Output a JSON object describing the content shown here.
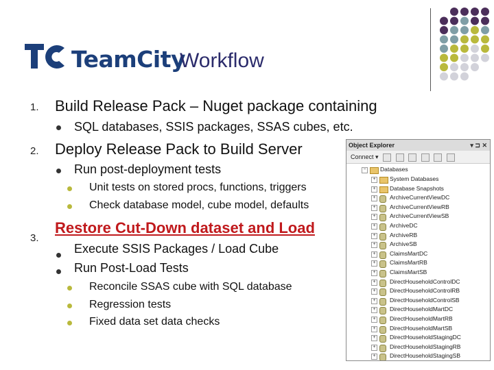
{
  "header": {
    "logo_text": "TeamCity",
    "title": "Workflow"
  },
  "colors": {
    "dot_purple": "#4b2e5a",
    "dot_teal": "#7f9ea6",
    "dot_olive": "#b9b93c",
    "dot_grey": "#d2d2da",
    "link_red": "#c0191c"
  },
  "outline": [
    {
      "num": "1.",
      "text": "Build Release Pack – Nuget package containing",
      "children": [
        {
          "text": "SQL databases, SSIS packages, SSAS cubes, etc."
        }
      ]
    },
    {
      "num": "2.",
      "text": "Deploy Release Pack to Build Server",
      "children": [
        {
          "text": "Run post-deployment tests",
          "children": [
            "Unit tests on stored procs, functions, triggers",
            "Check database model, cube model, defaults"
          ]
        }
      ]
    },
    {
      "num": "3.",
      "text": "Restore Cut-Down dataset and Load",
      "children": [
        {
          "text": "Execute SSIS Packages / Load Cube"
        },
        {
          "text": "Run Post-Load Tests",
          "children": [
            "Reconcile SSAS cube with SQL database",
            "Regression tests",
            "Fixed data set data checks"
          ]
        }
      ]
    }
  ],
  "object_explorer": {
    "title": "Object Explorer",
    "connect_label": "Connect ▾",
    "root": "Databases",
    "items": [
      "System Databases",
      "Database Snapshots",
      "ArchiveCurrentViewDC",
      "ArchiveCurrentViewRB",
      "ArchiveCurrentViewSB",
      "ArchiveDC",
      "ArchiveRB",
      "ArchiveSB",
      "ClaimsMartDC",
      "ClaimsMartRB",
      "ClaimsMartSB",
      "DirectHouseholdControlDC",
      "DirectHouseholdControlRB",
      "DirectHouseholdControlSB",
      "DirectHouseholdMartDC",
      "DirectHouseholdMartRB",
      "DirectHouseholdMartSB",
      "DirectHouseholdStagingDC",
      "DirectHouseholdStagingRB",
      "DirectHouseholdStagingSB"
    ]
  }
}
